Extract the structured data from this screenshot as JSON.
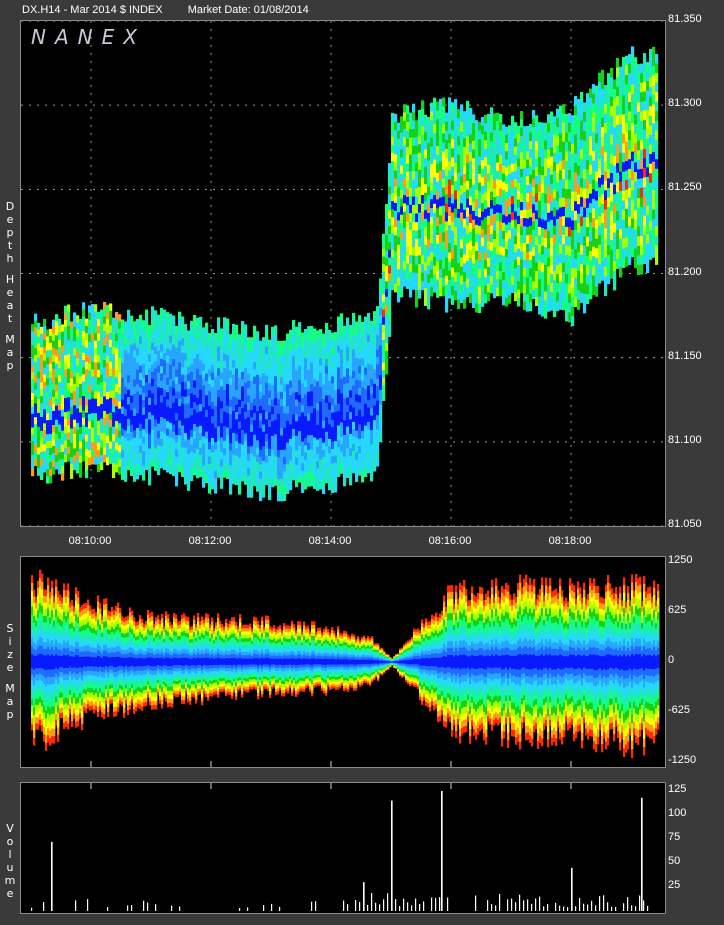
{
  "header": {
    "symbol": "DX.H14 - Mar 2014 $ INDEX",
    "market_date": "Market Date: 01/08/2014"
  },
  "logo": "NANEX",
  "panel_labels": {
    "depth": [
      "D",
      "e",
      "p",
      "t",
      "h",
      "",
      "H",
      "e",
      "a",
      "t",
      "",
      "M",
      "a",
      "p"
    ],
    "size": [
      "S",
      "i",
      "z",
      "e",
      "",
      "M",
      "a",
      "p"
    ],
    "volume": [
      "V",
      "o",
      "l",
      "u",
      "m",
      "e"
    ]
  },
  "colors": {
    "background": "#000000",
    "frame": "#3a3a3a",
    "heat_scale": [
      "#0a1aff",
      "#1f6bff",
      "#2aa5ff",
      "#26d7ff",
      "#1fe8c0",
      "#14ff80",
      "#18d018",
      "#a8ff00",
      "#ffff00",
      "#ff9a1a",
      "#ff2a00"
    ],
    "volume_bar": "#ffffff",
    "grid": "#9a9a9a"
  },
  "chart_data": [
    {
      "type": "heatmap",
      "name_on_chart": "Depth Heat Map",
      "x_ticks": [
        "08:10:00",
        "08:12:00",
        "08:14:00",
        "08:16:00",
        "08:18:00"
      ],
      "y_ticks": [
        "81.350",
        "81.300",
        "81.250",
        "81.200",
        "81.150",
        "81.100",
        "81.050"
      ],
      "ylim": [
        81.05,
        81.35
      ],
      "regime_change_time": "08:14:50",
      "price_bands": [
        {
          "time": "08:09:00",
          "low": 81.08,
          "high": 81.17
        },
        {
          "time": "08:10:00",
          "low": 81.085,
          "high": 81.18
        },
        {
          "time": "08:11:00",
          "low": 81.08,
          "high": 81.175
        },
        {
          "time": "08:12:00",
          "low": 81.075,
          "high": 81.17
        },
        {
          "time": "08:13:00",
          "low": 81.07,
          "high": 81.165
        },
        {
          "time": "08:14:00",
          "low": 81.075,
          "high": 81.17
        },
        {
          "time": "08:14:45",
          "low": 81.08,
          "high": 81.175
        },
        {
          "time": "08:15:00",
          "low": 81.19,
          "high": 81.295
        },
        {
          "time": "08:16:00",
          "low": 81.18,
          "high": 81.3
        },
        {
          "time": "08:17:00",
          "low": 81.185,
          "high": 81.29
        },
        {
          "time": "08:18:00",
          "low": 81.175,
          "high": 81.3
        },
        {
          "time": "08:19:00",
          "low": 81.205,
          "high": 81.33
        }
      ]
    },
    {
      "type": "area",
      "name_on_chart": "Size Map",
      "y_ticks": [
        "1250",
        "625",
        "0",
        "-625",
        "-1250"
      ],
      "ylim": [
        -1250,
        1250
      ],
      "x": [
        "08:09:00",
        "08:10:00",
        "08:11:00",
        "08:12:00",
        "08:13:00",
        "08:14:00",
        "08:14:40",
        "08:15:00",
        "08:16:00",
        "08:17:00",
        "08:18:00",
        "08:19:00"
      ],
      "upper_envelope": [
        1100,
        780,
        600,
        560,
        530,
        450,
        300,
        50,
        950,
        1000,
        980,
        1000
      ],
      "lower_envelope": [
        -1100,
        -720,
        -560,
        -480,
        -420,
        -380,
        -300,
        -50,
        -930,
        -1000,
        -980,
        -1100
      ]
    },
    {
      "type": "bar",
      "name_on_chart": "Volume",
      "y_ticks": [
        "125",
        "100",
        "75",
        "50",
        "25"
      ],
      "ylim": [
        0,
        125
      ],
      "spikes": [
        {
          "time": "08:09:20",
          "value": 72
        },
        {
          "time": "08:14:32",
          "value": 30
        },
        {
          "time": "08:15:00",
          "value": 115
        },
        {
          "time": "08:15:50",
          "value": 125
        },
        {
          "time": "08:18:00",
          "value": 45
        },
        {
          "time": "08:19:10",
          "value": 118
        }
      ]
    }
  ]
}
